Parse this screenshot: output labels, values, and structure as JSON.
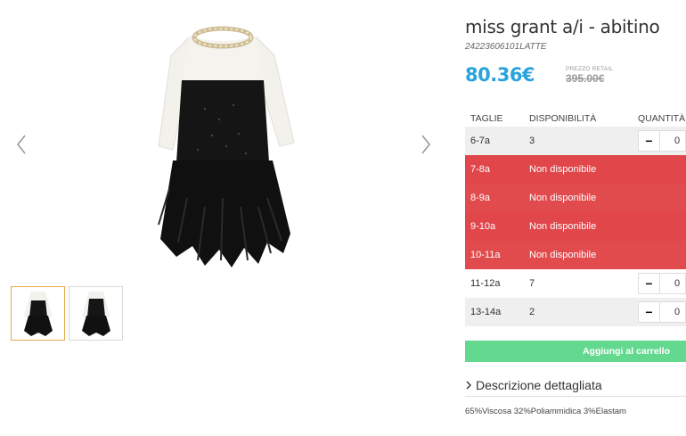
{
  "product": {
    "title": "miss grant a/i - abitino",
    "sku": "24223606101LATTE",
    "price": "80.36€",
    "retail_label": "PREZZO RETAIL",
    "retail_price": "395.00€"
  },
  "gallery": {
    "prev_icon": "chevron-left-icon",
    "next_icon": "chevron-right-icon",
    "thumbnails": [
      {
        "name": "front-view",
        "active": true
      },
      {
        "name": "back-view",
        "active": false
      }
    ]
  },
  "table": {
    "headers": {
      "size": "TAGLIE",
      "availability": "DISPONIBILITÀ",
      "quantity": "QUANTITÀ"
    },
    "rows": [
      {
        "size": "6-7a",
        "availability": "3",
        "qty": "0",
        "available": true
      },
      {
        "size": "7-8a",
        "availability": "Non disponibile",
        "available": false
      },
      {
        "size": "8-9a",
        "availability": "Non disponibile",
        "available": false
      },
      {
        "size": "9-10a",
        "availability": "Non disponibile",
        "available": false
      },
      {
        "size": "10-11a",
        "availability": "Non disponibile",
        "available": false
      },
      {
        "size": "11-12a",
        "availability": "7",
        "qty": "0",
        "available": true
      },
      {
        "size": "13-14a",
        "availability": "2",
        "qty": "0",
        "available": true
      }
    ],
    "minus_symbol": "−"
  },
  "cart": {
    "add_label": "Aggiungi al carrello"
  },
  "description": {
    "toggle_label": "Descrizione dettagliata",
    "composition": "65%Viscosa 32%Poliammidica 3%Elastam"
  },
  "colors": {
    "price": "#2aa3dc",
    "unavailable": "#e0464a",
    "add_button": "#63d98f",
    "thumb_active_border": "#e6a94a"
  }
}
